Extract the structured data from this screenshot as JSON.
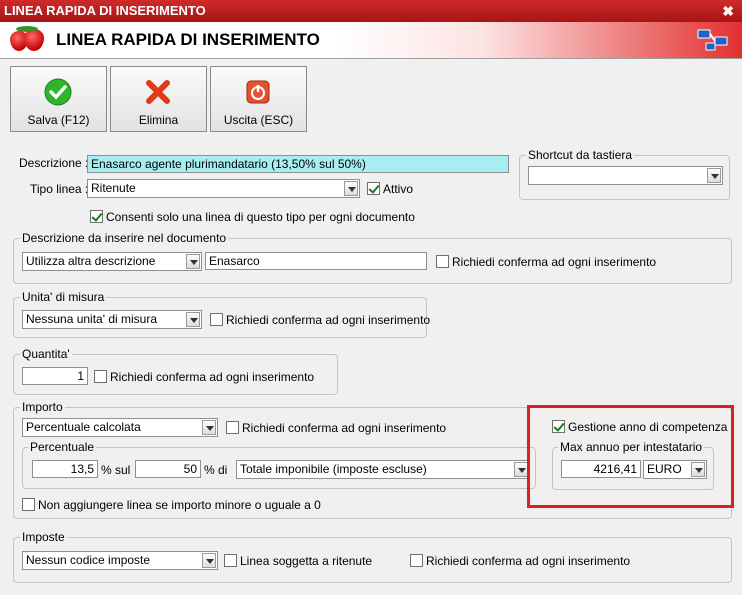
{
  "window": {
    "title": "LINEA RAPIDA DI INSERIMENTO",
    "close": "✖"
  },
  "header": {
    "title": "LINEA RAPIDA DI INSERIMENTO"
  },
  "toolbar": {
    "save": "Salva (F12)",
    "delete": "Elimina",
    "exit": "Uscita (ESC)"
  },
  "form": {
    "descrizione_label": "Descrizione :",
    "descrizione_value": "Enasarco agente plurimandatario (13,50% sul 50%)",
    "tipo_label": "Tipo linea :",
    "tipo_value": "Ritenute",
    "attivo_label": "Attivo",
    "consenti_label": "Consenti solo una linea di questo tipo per ogni documento"
  },
  "shortcut": {
    "legend": "Shortcut da tastiera",
    "value": ""
  },
  "descrizione_doc": {
    "legend": "Descrizione da inserire nel documento",
    "combo": "Utilizza altra descrizione",
    "text": "Enasarco",
    "conferma": "Richiedi conferma ad ogni inserimento"
  },
  "unita": {
    "legend": "Unita' di misura",
    "combo": "Nessuna unita' di misura",
    "conferma": "Richiedi conferma ad ogni inserimento"
  },
  "quantita": {
    "legend": "Quantita'",
    "value": "1",
    "conferma": "Richiedi conferma ad ogni inserimento"
  },
  "importo": {
    "legend": "Importo",
    "combo": "Percentuale calcolata",
    "conferma": "Richiedi conferma ad ogni inserimento",
    "percentuale_legend": "Percentuale",
    "perc1": "13,5",
    "perc_sul": "% sul",
    "perc2": "50",
    "perc_di": "% di",
    "base": "Totale imponibile (imposte escluse)",
    "gestione": "Gestione anno di competenza",
    "max_legend": "Max annuo per intestatario",
    "max_value": "4216,41",
    "valuta": "EURO",
    "non_aggiungere": "Non aggiungere linea se importo minore o uguale a 0"
  },
  "imposte": {
    "legend": "Imposte",
    "combo": "Nessun codice imposte",
    "ritenute": "Linea soggetta a ritenute",
    "conferma": "Richiedi conferma ad ogni inserimento"
  }
}
